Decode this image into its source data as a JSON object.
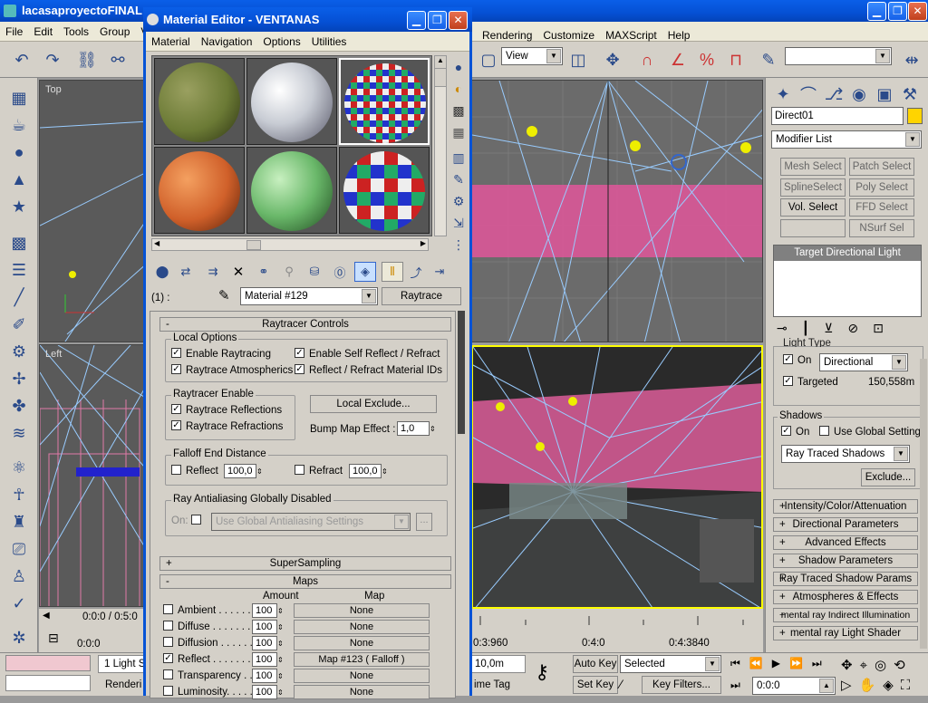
{
  "main_window": {
    "title": "lacasaproyectoFINAL",
    "menu": [
      "File",
      "Edit",
      "Tools",
      "Group",
      "Vie"
    ],
    "menu_right": [
      "Rendering",
      "Customize",
      "MAXScript",
      "Help"
    ],
    "view_dropdown": "View"
  },
  "viewports": {
    "top_label": "Top",
    "left_label": "Left",
    "timeline_frame": "0:0:0 / 0:5:0",
    "timeline_ticks": [
      "0:3:960",
      "0:4:0",
      "0:4:3840"
    ],
    "timeline_start": "0:0:0"
  },
  "status": {
    "light_count": "1 Light S",
    "rendering": "Renderi",
    "time_tag": "ime Tag",
    "coord": "10,0m",
    "auto_key": "Auto Key",
    "set_key": "Set Key",
    "selected": "Selected",
    "key_filters": "Key Filters...",
    "frame": "0:0:0"
  },
  "command_panel": {
    "object_name": "Direct01",
    "modifier_list": "Modifier List",
    "modifier_buttons": [
      "Mesh Select",
      "Patch Select",
      "SplineSelect",
      "Poly Select",
      "Vol. Select",
      "FFD Select",
      "NSurf Sel"
    ],
    "stack_item": "Target Directional Light",
    "light_type": {
      "header": "Light Type",
      "on_label": "On",
      "type": "Directional",
      "targeted_label": "Targeted",
      "distance": "150,558m"
    },
    "shadows": {
      "header": "Shadows",
      "on_label": "On",
      "global_label": "Use Global Settings",
      "type": "Ray Traced Shadows",
      "exclude": "Exclude..."
    },
    "rollouts": [
      "Intensity/Color/Attenuation",
      "Directional Parameters",
      "Advanced Effects",
      "Shadow Parameters",
      "Ray Traced Shadow Params",
      "Atmospheres & Effects",
      "mental ray Indirect Illumination",
      "mental ray Light Shader"
    ]
  },
  "material_editor": {
    "title": "Material Editor - VENTANAS",
    "menu": [
      "Material",
      "Navigation",
      "Options",
      "Utilities"
    ],
    "slot_index": "(1) :",
    "material_name": "Material #129",
    "material_type": "Raytrace",
    "raytracer_controls": "Raytracer Controls",
    "local_options": {
      "title": "Local Options",
      "items": [
        "Enable Raytracing",
        "Enable Self Reflect / Refract",
        "Raytrace Atmospherics",
        "Reflect / Refract Material IDs"
      ]
    },
    "raytracer_enable": {
      "title": "Raytracer Enable",
      "items": [
        "Raytrace Reflections",
        "Raytrace Refractions"
      ]
    },
    "local_exclude": "Local Exclude...",
    "bump_map_effect_label": "Bump Map Effect :",
    "bump_map_effect": "1,0",
    "falloff": {
      "title": "Falloff End Distance",
      "reflect": "Reflect",
      "reflect_val": "100,0",
      "refract": "Refract",
      "refract_val": "100,0"
    },
    "antialias": {
      "title": "Ray Antialiasing Globally Disabled",
      "on": "On:",
      "setting": "Use Global Antialiasing Settings",
      "btn": "..."
    },
    "supersampling": "SuperSampling",
    "maps": "Maps",
    "maps_header": {
      "amount": "Amount",
      "map": "Map"
    },
    "map_rows": [
      {
        "name": "Ambient . . . . . . .",
        "amount": "100",
        "map": "None",
        "checked": false
      },
      {
        "name": "Diffuse . . . . . . .",
        "amount": "100",
        "map": "None",
        "checked": false
      },
      {
        "name": "Diffusion . . . . . .",
        "amount": "100",
        "map": "None",
        "checked": false
      },
      {
        "name": "Reflect . . . . . . .",
        "amount": "100",
        "map": "Map #123  ( Falloff )",
        "checked": true
      },
      {
        "name": "Transparency . . .",
        "amount": "100",
        "map": "None",
        "checked": false
      },
      {
        "name": "Luminosity. . . . .",
        "amount": "100",
        "map": "None",
        "checked": false
      }
    ]
  }
}
